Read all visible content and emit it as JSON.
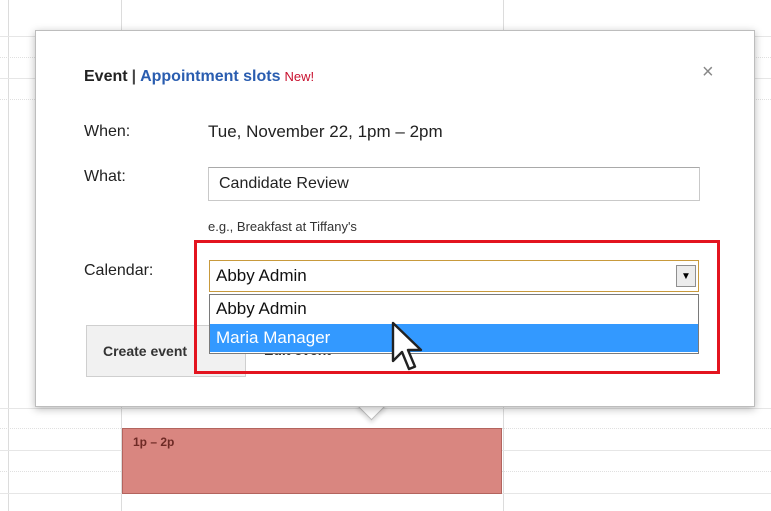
{
  "popup": {
    "tab_event": "Event",
    "tab_separator": "|",
    "tab_appointment": "Appointment slots",
    "new_badge": "New!",
    "close_glyph": "×",
    "when_label": "When:",
    "when_value": "Tue, November 22, 1pm – 2pm",
    "what_label": "What:",
    "what_value": "Candidate Review",
    "what_hint": "e.g., Breakfast at Tiffany's",
    "calendar_label": "Calendar:",
    "calendar_selected": "Abby Admin",
    "calendar_options": [
      "Abby Admin",
      "Maria Manager"
    ],
    "create_button": "Create event",
    "edit_button": "Edit event »"
  },
  "calendar": {
    "event_time": "1p – 2p"
  },
  "colors": {
    "link": "#2a5db0",
    "new_badge": "#c8102e",
    "highlight_border": "#e3141f",
    "selected_option": "#3399ff",
    "event_fill": "#d98680"
  }
}
